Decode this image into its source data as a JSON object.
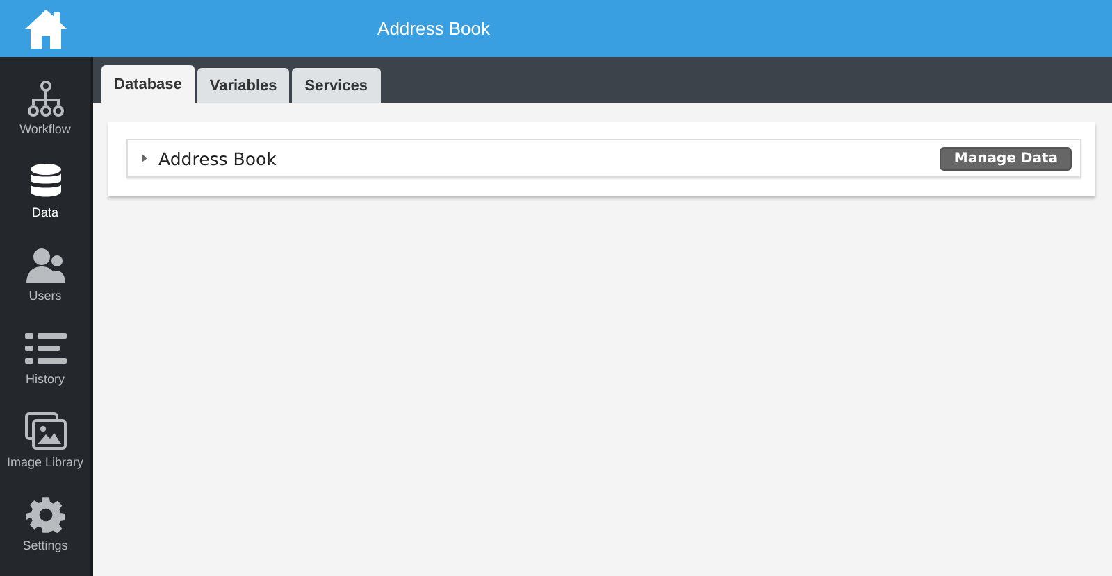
{
  "header": {
    "title": "Address Book"
  },
  "sidebar": {
    "items": [
      {
        "kind": "workflow",
        "label": "Workflow",
        "selected": false
      },
      {
        "kind": "data",
        "label": "Data",
        "selected": true
      },
      {
        "kind": "users",
        "label": "Users",
        "selected": false
      },
      {
        "kind": "history",
        "label": "History",
        "selected": false
      },
      {
        "kind": "images",
        "label": "Image Library",
        "selected": false
      },
      {
        "kind": "settings",
        "label": "Settings",
        "selected": false
      }
    ]
  },
  "tabs": [
    {
      "label": "Database",
      "selected": true
    },
    {
      "label": "Variables",
      "selected": false
    },
    {
      "label": "Services",
      "selected": false
    }
  ],
  "databases": [
    {
      "name": "Address Book",
      "expanded": false,
      "action": "Manage Data"
    }
  ]
}
